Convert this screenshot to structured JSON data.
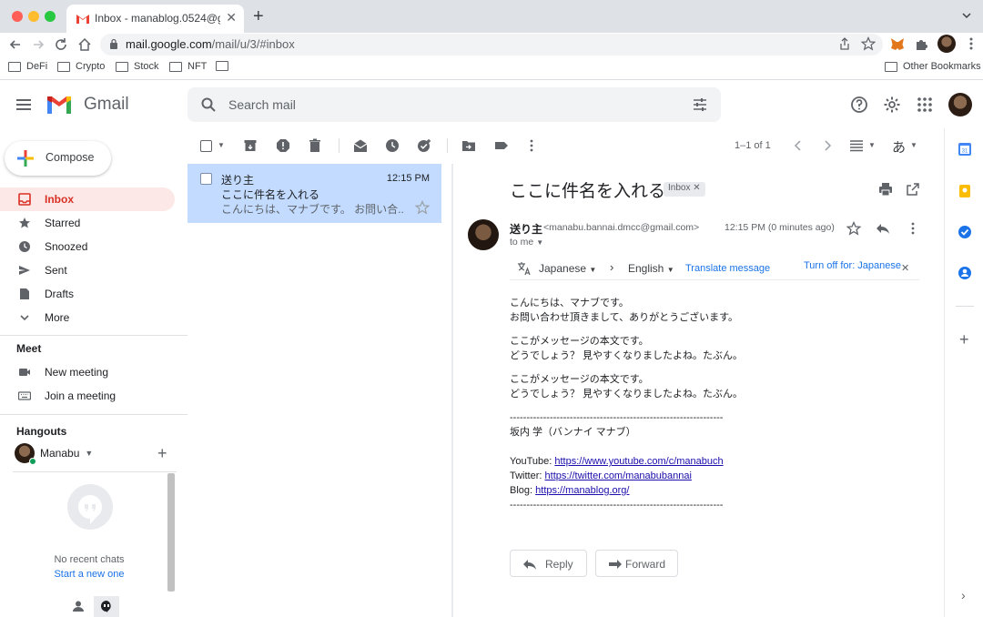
{
  "browser": {
    "tab_title": "Inbox - manablog.0524@gmail",
    "url_host": "mail.google.com",
    "url_path": "/mail/u/3/#inbox",
    "bookmarks": [
      "DeFi",
      "Crypto",
      "Stock",
      "NFT"
    ],
    "other_bookmarks": "Other Bookmarks"
  },
  "header": {
    "app_name": "Gmail",
    "search_placeholder": "Search mail"
  },
  "nav": {
    "compose": "Compose",
    "items": [
      {
        "label": "Inbox",
        "icon": "inbox-icon",
        "active": true
      },
      {
        "label": "Starred",
        "icon": "star-icon"
      },
      {
        "label": "Snoozed",
        "icon": "clock-icon"
      },
      {
        "label": "Sent",
        "icon": "send-icon"
      },
      {
        "label": "Drafts",
        "icon": "draft-icon"
      },
      {
        "label": "More",
        "icon": "chevron-down-icon"
      }
    ],
    "meet_title": "Meet",
    "meet_items": [
      {
        "label": "New meeting",
        "icon": "video-icon"
      },
      {
        "label": "Join a meeting",
        "icon": "keyboard-icon"
      }
    ],
    "hangouts_title": "Hangouts",
    "hangouts_user": "Manabu",
    "no_chats": "No recent chats",
    "start_new": "Start a new one"
  },
  "toolbar": {
    "count": "1–1 of 1"
  },
  "message_list": [
    {
      "sender": "送り主",
      "time": "12:15 PM",
      "subject": "ここに件名を入れる",
      "snippet": "こんにちは、マナブです。 お問い合..."
    }
  ],
  "email": {
    "subject": "ここに件名を入れる",
    "label": "Inbox",
    "sender_name": "送り主",
    "sender_email": "<manabu.bannai.dmcc@gmail.com>",
    "to": "to me",
    "time": "12:15 PM (0 minutes ago)",
    "translate": {
      "from": "Japanese",
      "to": "English",
      "action": "Translate message",
      "turn_off": "Turn off for: Japanese"
    },
    "body": {
      "p1_l1": "こんにちは、マナブです。",
      "p1_l2": "お問い合わせ頂きまして、ありがとうございます。",
      "p2_l1": "ここがメッセージの本文です。",
      "p2_l2": "どうでしょう？ 見やすくなりましたよね。たぶん。",
      "p3_l1": "ここがメッセージの本文です。",
      "p3_l2": "どうでしょう？ 見やすくなりましたよね。たぶん。",
      "separator": "----------------------------------------------------------------",
      "signature_name": "坂内 学（バンナイ マナブ）",
      "youtube_label": "YouTube:",
      "youtube_url": "https://www.youtube.com/c/manabuch",
      "twitter_label": "Twitter:",
      "twitter_url": "https://twitter.com/manabubannai",
      "blog_label": "Blog:",
      "blog_url": "https://manablog.org/"
    },
    "reply": "Reply",
    "forward": "Forward"
  },
  "colors": {
    "gmail_red": "#d93025",
    "selected_row": "#c2dbff",
    "link_blue": "#1a73e8"
  }
}
